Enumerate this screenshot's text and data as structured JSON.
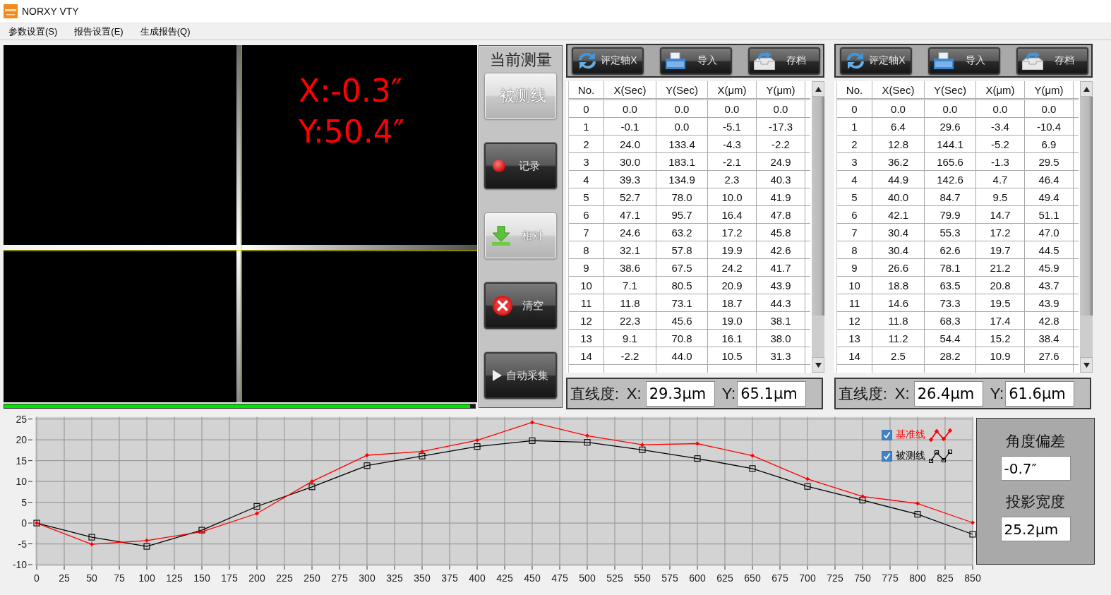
{
  "window": {
    "title": "NORXY VTY"
  },
  "menu": [
    {
      "label": "参数设置(S)"
    },
    {
      "label": "报告设置(E)"
    },
    {
      "label": "生成报告(Q)"
    }
  ],
  "camera": {
    "readouts": [
      "X:-0.3″",
      "Y:50.4″"
    ],
    "progress": {
      "level": 0.99
    }
  },
  "measure_panel": {
    "title": "当前测量",
    "buttons": [
      {
        "label": "被测线",
        "kind": "toggle",
        "on": true
      },
      {
        "label": "记录",
        "kind": "record",
        "on": false
      },
      {
        "label": "相对",
        "kind": "relative",
        "on": true
      },
      {
        "label": "清空",
        "kind": "clear",
        "on": false
      },
      {
        "label": "自动采集",
        "kind": "auto",
        "on": false
      }
    ]
  },
  "tables": [
    {
      "toolbar": [
        {
          "label": "评定轴X",
          "kind": "evaluate"
        },
        {
          "label": "导入",
          "kind": "import"
        },
        {
          "label": "存档",
          "kind": "archive"
        }
      ],
      "columns": [
        "No.",
        "X(Sec)",
        "Y(Sec)",
        "X(μm)",
        "Y(μm)"
      ],
      "rows": [
        [
          "0",
          "0.0",
          "0.0",
          "0.0",
          "0.0"
        ],
        [
          "1",
          "-0.1",
          "0.0",
          "-5.1",
          "-17.3"
        ],
        [
          "2",
          "24.0",
          "133.4",
          "-4.3",
          "-2.2"
        ],
        [
          "3",
          "30.0",
          "183.1",
          "-2.1",
          "24.9"
        ],
        [
          "4",
          "39.3",
          "134.9",
          "2.3",
          "40.3"
        ],
        [
          "5",
          "52.7",
          "78.0",
          "10.0",
          "41.9"
        ],
        [
          "6",
          "47.1",
          "95.7",
          "16.4",
          "47.8"
        ],
        [
          "7",
          "24.6",
          "63.2",
          "17.2",
          "45.8"
        ],
        [
          "8",
          "32.1",
          "57.8",
          "19.9",
          "42.6"
        ],
        [
          "9",
          "38.6",
          "67.5",
          "24.2",
          "41.7"
        ],
        [
          "10",
          "7.1",
          "80.5",
          "20.9",
          "43.9"
        ],
        [
          "11",
          "11.8",
          "73.1",
          "18.7",
          "44.3"
        ],
        [
          "12",
          "22.3",
          "45.6",
          "19.0",
          "38.1"
        ],
        [
          "13",
          "9.1",
          "70.8",
          "16.1",
          "38.0"
        ],
        [
          "14",
          "-2.2",
          "44.0",
          "10.5",
          "31.3"
        ]
      ],
      "straightness": {
        "label": "直线度:",
        "x_label": "X:",
        "x_value": "29.3μm",
        "y_label": "Y:",
        "y_value": "65.1μm"
      }
    },
    {
      "toolbar": [
        {
          "label": "评定轴X",
          "kind": "evaluate"
        },
        {
          "label": "导入",
          "kind": "import"
        },
        {
          "label": "存档",
          "kind": "archive"
        }
      ],
      "columns": [
        "No.",
        "X(Sec)",
        "Y(Sec)",
        "X(μm)",
        "Y(μm)"
      ],
      "rows": [
        [
          "0",
          "0.0",
          "0.0",
          "0.0",
          "0.0"
        ],
        [
          "1",
          "6.4",
          "29.6",
          "-3.4",
          "-10.4"
        ],
        [
          "2",
          "12.8",
          "144.1",
          "-5.2",
          "6.9"
        ],
        [
          "3",
          "36.2",
          "165.6",
          "-1.3",
          "29.5"
        ],
        [
          "4",
          "44.9",
          "142.6",
          "4.7",
          "46.4"
        ],
        [
          "5",
          "40.0",
          "84.7",
          "9.5",
          "49.4"
        ],
        [
          "6",
          "42.1",
          "79.9",
          "14.7",
          "51.1"
        ],
        [
          "7",
          "30.4",
          "55.3",
          "17.2",
          "47.0"
        ],
        [
          "8",
          "30.4",
          "62.6",
          "19.7",
          "44.5"
        ],
        [
          "9",
          "26.6",
          "78.1",
          "21.2",
          "45.9"
        ],
        [
          "10",
          "18.8",
          "63.5",
          "20.8",
          "43.7"
        ],
        [
          "11",
          "14.6",
          "73.3",
          "19.5",
          "43.9"
        ],
        [
          "12",
          "11.8",
          "68.3",
          "17.4",
          "42.8"
        ],
        [
          "13",
          "11.2",
          "54.4",
          "15.2",
          "38.4"
        ],
        [
          "14",
          "2.5",
          "28.2",
          "10.9",
          "27.6"
        ]
      ],
      "straightness": {
        "label": "直线度:",
        "x_label": "X:",
        "x_value": "26.4μm",
        "y_label": "Y:",
        "y_value": "61.6μm"
      }
    }
  ],
  "chart": {
    "chart_data": {
      "type": "line",
      "x": [
        0,
        50,
        100,
        150,
        200,
        250,
        300,
        350,
        400,
        450,
        500,
        550,
        600,
        650,
        700,
        750,
        800,
        850
      ],
      "series": [
        {
          "name": "基准线",
          "color": "#ff0000",
          "marker": "diamond",
          "values": [
            0,
            -5.1,
            -4.2,
            -2.1,
            2.3,
            10.0,
            16.3,
            17.2,
            19.9,
            24.2,
            21.0,
            18.8,
            19.1,
            16.2,
            10.6,
            6.4,
            4.7,
            0.1
          ]
        },
        {
          "name": "被测线",
          "color": "#000000",
          "marker": "square",
          "values": [
            0,
            -3.4,
            -5.6,
            -1.7,
            4.0,
            8.7,
            13.8,
            16.1,
            18.4,
            19.8,
            19.4,
            17.6,
            15.5,
            13.1,
            8.8,
            5.5,
            2.1,
            -2.7
          ]
        }
      ],
      "xlim": [
        0,
        850
      ],
      "ylim": [
        -10,
        25
      ],
      "xticks": [
        0,
        25,
        50,
        75,
        100,
        125,
        150,
        175,
        200,
        225,
        250,
        275,
        300,
        325,
        350,
        375,
        400,
        425,
        450,
        475,
        500,
        525,
        550,
        575,
        600,
        625,
        650,
        675,
        700,
        725,
        750,
        775,
        800,
        825,
        850
      ],
      "yticks": [
        -10,
        -5,
        0,
        5,
        10,
        15,
        20,
        25
      ],
      "grid": true
    },
    "legend": [
      {
        "checked": true
      },
      {
        "checked": true
      }
    ]
  },
  "deviation_panel": {
    "angle_label": "角度偏差",
    "angle_value": "-0.7″",
    "width_label": "投影宽度",
    "width_value": "25.2μm"
  }
}
